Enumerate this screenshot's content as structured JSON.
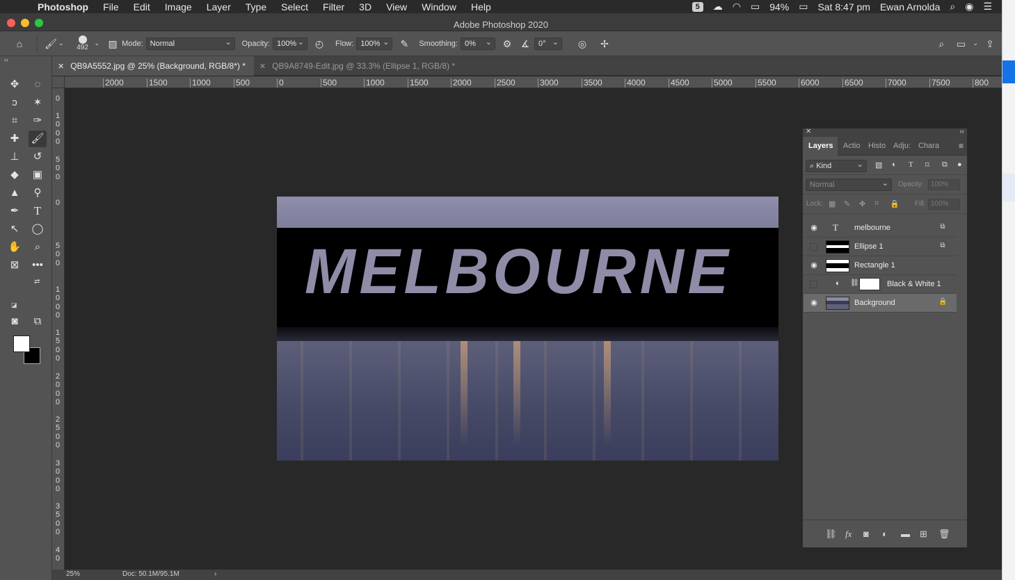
{
  "menubar": {
    "app_name": "Photoshop",
    "items": [
      "File",
      "Edit",
      "Image",
      "Layer",
      "Type",
      "Select",
      "Filter",
      "3D",
      "View",
      "Window",
      "Help"
    ],
    "battery": "94%",
    "clock": "Sat 8:47 pm",
    "user": "Ewan Arnolda"
  },
  "window": {
    "title": "Adobe Photoshop 2020"
  },
  "options": {
    "brush_size": "492",
    "mode_label": "Mode:",
    "mode_value": "Normal",
    "opacity_label": "Opacity:",
    "opacity_value": "100%",
    "flow_label": "Flow:",
    "flow_value": "100%",
    "smoothing_label": "Smoothing:",
    "smoothing_value": "0%",
    "angle_value": "0°"
  },
  "tabs": [
    {
      "label": "QB9A5552.jpg @ 25% (Background, RGB/8*) *",
      "active": true
    },
    {
      "label": "QB9A8749-Edit.jpg @ 33.3% (Ellipse 1, RGB/8) *",
      "active": false
    }
  ],
  "ruler_top": [
    "2000",
    "1500",
    "1000",
    "500",
    "0",
    "500",
    "1000",
    "1500",
    "2000",
    "2500",
    "3000",
    "3500",
    "4000",
    "4500",
    "5000",
    "5500",
    "6000",
    "6500",
    "7000",
    "7500",
    "800"
  ],
  "ruler_left": [
    "0",
    "1\n0\n0\n0",
    "5\n0\n0",
    "0",
    "5\n0\n0",
    "1\n0\n0\n0",
    "1\n5\n0\n0",
    "2\n0\n0\n0",
    "2\n5\n0\n0",
    "3\n0\n0\n0",
    "3\n5\n0\n0",
    "4\n0"
  ],
  "canvas": {
    "headline": "MELBOURNE"
  },
  "status": {
    "zoom": "25%",
    "doc": "Doc: 50.1M/95.1M"
  },
  "layers_panel": {
    "tabs": [
      "Layers",
      "Actio",
      "Histo",
      "Adju:",
      "Chara"
    ],
    "kind_label": "Kind",
    "blend_mode": "Normal",
    "opacity_label": "Opacity:",
    "opacity_value": "100%",
    "lock_label": "Lock:",
    "fill_label": "Fill:",
    "fill_value": "100%",
    "layers": [
      {
        "name": "melbourne",
        "visible": true,
        "kind": "text"
      },
      {
        "name": "Ellipse 1",
        "visible": false,
        "kind": "shape"
      },
      {
        "name": "Rectangle 1",
        "visible": true,
        "kind": "shape"
      },
      {
        "name": "Black & White 1",
        "visible": false,
        "kind": "adjustment"
      },
      {
        "name": "Background",
        "visible": true,
        "kind": "image",
        "selected": true
      }
    ]
  }
}
